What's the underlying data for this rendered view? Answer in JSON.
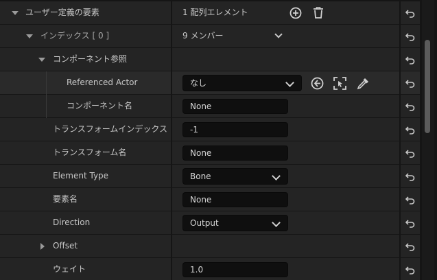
{
  "rows": {
    "user_elements": {
      "label": "ユーザー定義の要素",
      "value": "1 配列エレメント"
    },
    "index": {
      "label": "インデックス [ 0 ]",
      "value": "9 メンバー"
    },
    "component_ref": {
      "label": "コンポーネント参照"
    },
    "referenced_actor": {
      "label": "Referenced Actor",
      "value": "なし"
    },
    "component_name": {
      "label": "コンポーネント名",
      "value": "None"
    },
    "transform_index": {
      "label": "トランスフォームインデックス",
      "value": "-1"
    },
    "transform_name": {
      "label": "トランスフォーム名",
      "value": "None"
    },
    "element_type": {
      "label": "Element Type",
      "value": "Bone"
    },
    "element_name": {
      "label": "要素名",
      "value": "None"
    },
    "direction": {
      "label": "Direction",
      "value": "Output"
    },
    "offset": {
      "label": "Offset"
    },
    "weight": {
      "label": "ウェイト",
      "value": "1.0"
    }
  },
  "icons": {
    "add": "add-circle-icon",
    "delete": "trash-icon",
    "browse": "arrow-left-circle-icon",
    "select": "select-actor-icon",
    "picker": "eyedropper-icon",
    "reset": "reset-arrow-icon",
    "expand": "triangle-down-icon",
    "collapse": "triangle-right-icon"
  },
  "colors": {
    "background": "#151515",
    "row_primary": "#242424",
    "row_alt": "#1e1e1e",
    "input_bg": "#0f0f0f",
    "text": "#c8c8c8"
  }
}
